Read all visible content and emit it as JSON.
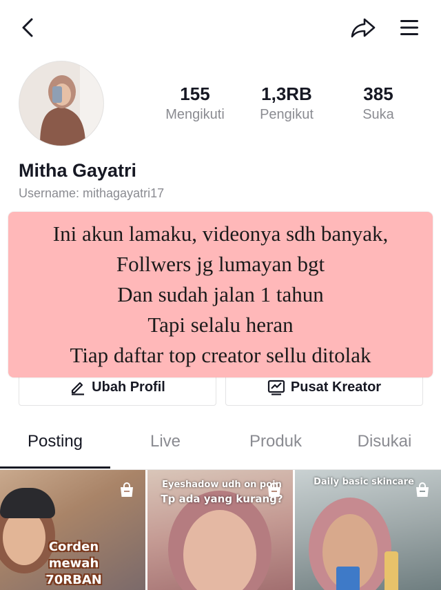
{
  "header": {
    "back_icon": "chevron-left-icon",
    "share_icon": "share-arrow-icon",
    "menu_icon": "hamburger-menu-icon"
  },
  "profile": {
    "name": "Mitha Gayatri",
    "username": "Username: mithagayatri17",
    "stats": [
      {
        "value": "155",
        "label": "Mengikuti"
      },
      {
        "value": "1,3RB",
        "label": "Pengikut"
      },
      {
        "value": "385",
        "label": "Suka"
      }
    ]
  },
  "overlay": {
    "lines": [
      "Ini akun lamaku, videonya sdh banyak,",
      "Follwers jg lumayan bgt",
      "Dan sudah jalan 1 tahun",
      "Tapi selalu heran",
      "Tiap daftar top creator sellu ditolak"
    ],
    "color": "#ffb8b9"
  },
  "actions": {
    "edit_profile": "Ubah Profil",
    "creator_center": "Pusat Kreator"
  },
  "tabs": [
    "Posting",
    "Live",
    "Produk",
    "Disukai"
  ],
  "videos": [
    {
      "caption_line1": "Corden mewah",
      "caption_line2": "70RBAN"
    },
    {
      "caption_line1": "Eyeshadow udh on poin",
      "caption_line2": "Tp ada yang kurang?"
    },
    {
      "caption_line1": "Daily basic skincare"
    }
  ]
}
